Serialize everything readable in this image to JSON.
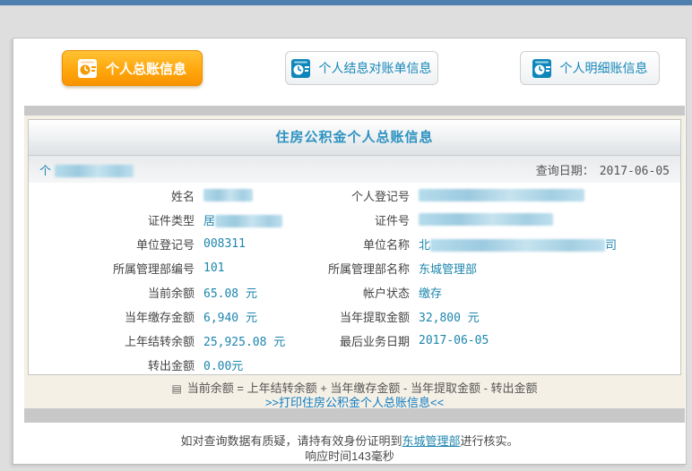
{
  "colors": {
    "topbar_blue": "#4d80ae",
    "active_tab_orange": "#ffa70e",
    "tab_text_blue": "#1787b8",
    "title_blue": "#2e93c1",
    "value_blue": "#1d85ad",
    "link_blue": "#0d7bc4",
    "beige_bg": "#f5f0e5"
  },
  "tabs": [
    {
      "label": "个人总账信息",
      "active": true
    },
    {
      "label": "个人结息对账单信息",
      "active": false
    },
    {
      "label": "个人明细账信息",
      "active": false
    }
  ],
  "panel": {
    "title": "住房公积金个人总账信息",
    "person_prefix": "个",
    "query_label": "查询日期：",
    "query_date": "2017-06-05"
  },
  "fields": {
    "rows": [
      {
        "l1": "姓名",
        "v1": "",
        "l2": "个人登记号",
        "v2": ""
      },
      {
        "l1": "证件类型",
        "v1": "居",
        "l2": "证件号",
        "v2": ""
      },
      {
        "l1": "单位登记号",
        "v1": "008311",
        "l2": "单位名称",
        "v2_prefix": "北",
        "v2_suffix": "司"
      },
      {
        "l1": "所属管理部编号",
        "v1": "101",
        "l2": "所属管理部名称",
        "v2": "东城管理部"
      },
      {
        "l1": "当前余额",
        "v1": "65.08 元",
        "l2": "帐户状态",
        "v2": "缴存"
      },
      {
        "l1": "当年缴存金额",
        "v1": "6,940 元",
        "l2": "当年提取金额",
        "v2": "32,800 元"
      },
      {
        "l1": "上年结转余额",
        "v1": "25,925.08 元",
        "l2": "最后业务日期",
        "v2": "2017-06-05"
      },
      {
        "l1": "转出金额",
        "v1": "0.00元",
        "l2": "",
        "v2": ""
      }
    ]
  },
  "formula": {
    "icon": "form-note-icon",
    "icon_glyph": "▤",
    "text": "当前余额 = 上年结转余额 + 当年缴存金额 - 当年提取金额 - 转出金额",
    "print_link": ">>打印住房公积金个人总账信息<<"
  },
  "footer": {
    "notice_before": "如对查询数据有质疑，请持有效身份证明到",
    "notice_link": "东城管理部",
    "notice_after": "进行核实。",
    "response_time": "响应时间143毫秒"
  }
}
